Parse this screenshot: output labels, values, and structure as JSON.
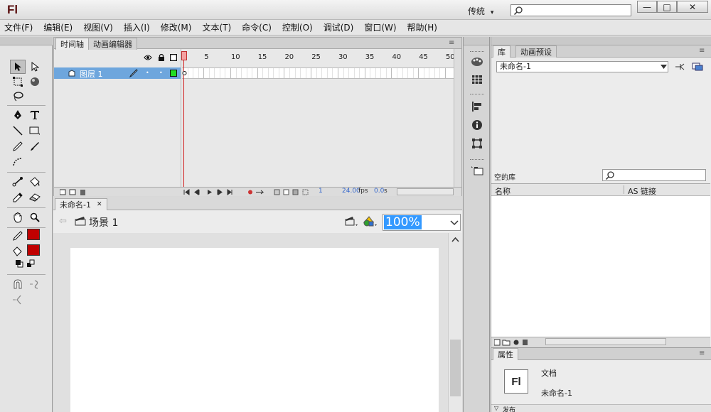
{
  "app": {
    "logo": "Fl",
    "workspace": "传统",
    "workspace_arrow": "▾"
  },
  "window_controls": {
    "minimize": "—",
    "maximize": "□",
    "close": "✕"
  },
  "menu": [
    "文件(F)",
    "编辑(E)",
    "视图(V)",
    "插入(I)",
    "修改(M)",
    "文本(T)",
    "命令(C)",
    "控制(O)",
    "调试(D)",
    "窗口(W)",
    "帮助(H)"
  ],
  "timeline": {
    "tabs": [
      "时间轴",
      "动画编辑器"
    ],
    "layer_name": "图层 1",
    "frame_numbers": [
      "1",
      "5",
      "10",
      "15",
      "20",
      "25",
      "30",
      "35",
      "40",
      "45",
      "50"
    ],
    "status": {
      "current_frame": "1",
      "fps": "24.00",
      "fps_unit": "fps",
      "time": "0.0",
      "time_unit": "s"
    }
  },
  "document": {
    "tab": "未命名-1",
    "close": "✕",
    "scene": "场景 1",
    "zoom": "100%"
  },
  "library": {
    "tabs": [
      "库",
      "动画预设"
    ],
    "selected_doc": "未命名-1",
    "empty_label": "空的库",
    "columns": {
      "name": "名称",
      "linkage": "AS 链接"
    }
  },
  "properties": {
    "tab": "属性",
    "doc_type": "文档",
    "doc_name": "未命名-1",
    "icon_text": "Fl",
    "publish": "发布"
  },
  "colors": {
    "stroke": "#c00000",
    "fill": "#c00000",
    "layer_highlight": "#6ea6dd",
    "playhead": "#d02020"
  }
}
